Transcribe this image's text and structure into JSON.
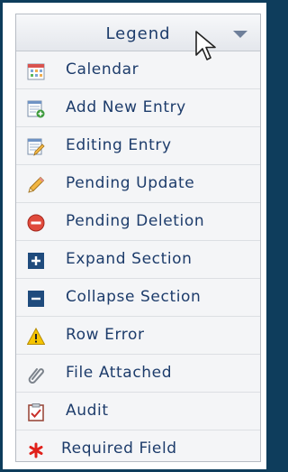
{
  "legend": {
    "title": "Legend",
    "items": [
      {
        "label": "Calendar",
        "icon": "calendar-icon"
      },
      {
        "label": "Add New Entry",
        "icon": "add-entry-icon"
      },
      {
        "label": "Editing Entry",
        "icon": "edit-entry-icon"
      },
      {
        "label": "Pending Update",
        "icon": "pencil-icon"
      },
      {
        "label": "Pending Deletion",
        "icon": "minus-circle-icon"
      },
      {
        "label": "Expand Section",
        "icon": "plus-square-icon"
      },
      {
        "label": "Collapse Section",
        "icon": "minus-square-icon"
      },
      {
        "label": "Row Error",
        "icon": "warning-icon"
      },
      {
        "label": "File Attached",
        "icon": "paperclip-icon"
      },
      {
        "label": "Audit",
        "icon": "clipboard-icon"
      },
      {
        "label": "Required Field",
        "icon": "asterisk-icon"
      }
    ]
  },
  "colors": {
    "frame": "#0e3d5c",
    "text": "#1d3c6b",
    "panel": "#f4f5f7"
  }
}
